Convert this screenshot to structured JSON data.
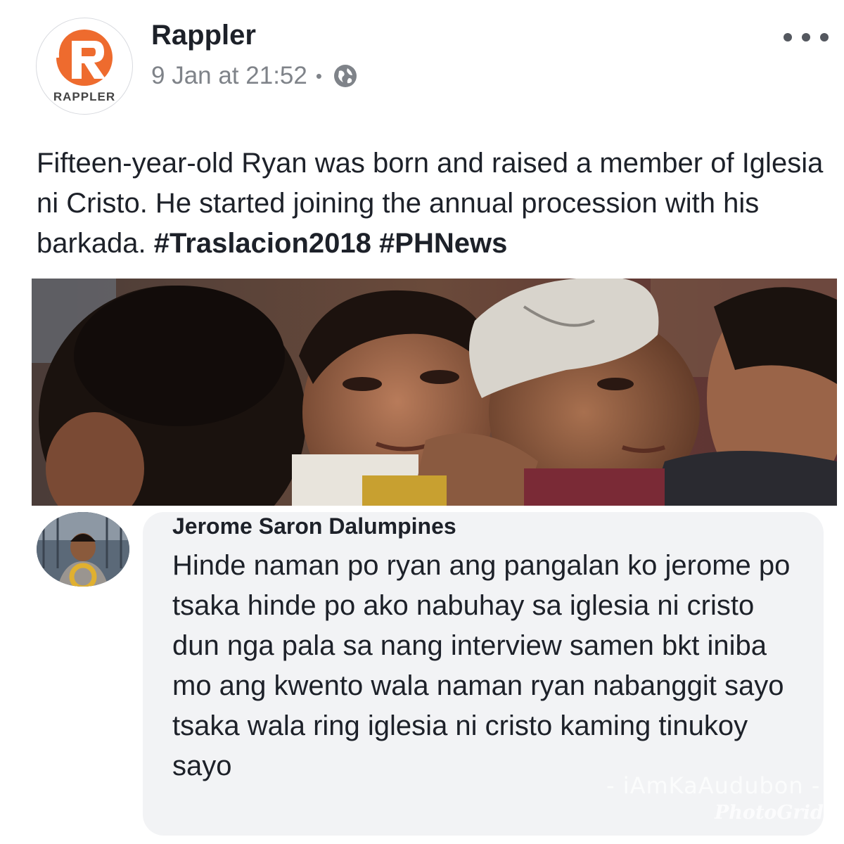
{
  "post": {
    "page_name": "Rappler",
    "logo_text": "RAPPLER",
    "timestamp": "9 Jan at 21:52",
    "separator": "•",
    "privacy_icon": "globe-icon",
    "more_icon": "more-horizontal-icon",
    "text_plain": "Fifteen-year-old Ryan was born and raised a member of Iglesia ni Cristo. He started joining the annual procession with his barkada. ",
    "hashtags": [
      "#Traslacion2018",
      "#PHNews"
    ],
    "photo": "crowd-photo"
  },
  "comment": {
    "author": "Jerome Saron Dalumpines",
    "avatar": "commenter-avatar-photo",
    "text": "Hinde naman po ryan ang pangalan ko jerome po tsaka hinde po ako nabuhay sa iglesia ni cristo dun nga pala sa nang interview samen bkt iniba mo ang kwento wala naman ryan nabanggit sayo tsaka wala ring iglesia ni cristo kaming tinukoy sayo"
  },
  "watermarks": {
    "line1": "- iAmKaAudubon -",
    "line2": "PhotoGrid"
  },
  "colors": {
    "brand": "#ee6b2e",
    "bubble": "#f2f3f5",
    "meta": "#7f8389"
  }
}
